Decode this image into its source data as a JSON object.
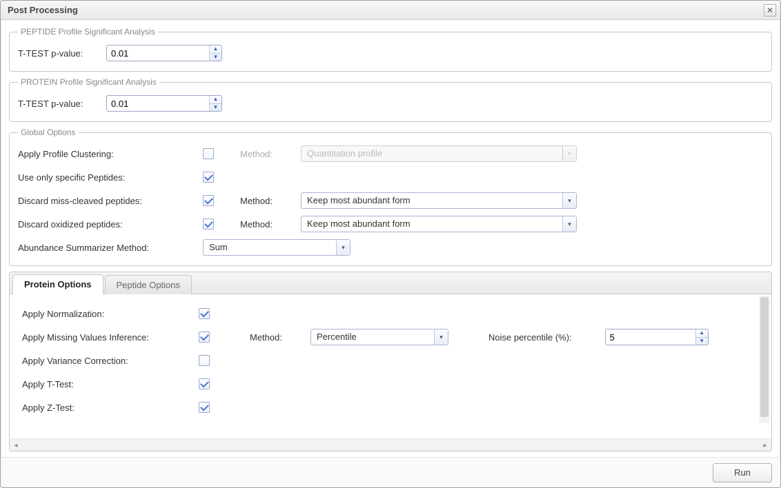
{
  "window": {
    "title": "Post Processing"
  },
  "peptide_profile": {
    "legend": "PEPTIDE Profile Significant Analysis",
    "pvalue_label": "T-TEST p-value:",
    "pvalue": "0.01"
  },
  "protein_profile": {
    "legend": "PROTEIN Profile Significant Analysis",
    "pvalue_label": "T-TEST p-value:",
    "pvalue": "0.01"
  },
  "global": {
    "legend": "Global Options",
    "rows": {
      "clustering": {
        "label": "Apply Profile Clustering:",
        "checked": false,
        "method_label": "Method:",
        "method_value": "Quantitation profile",
        "method_disabled": true
      },
      "specific": {
        "label": "Use only specific Peptides:",
        "checked": true
      },
      "miss_cleaved": {
        "label": "Discard miss-cleaved peptides:",
        "checked": true,
        "method_label": "Method:",
        "method_value": "Keep most abundant form"
      },
      "oxidized": {
        "label": "Discard oxidized peptides:",
        "checked": true,
        "method_label": "Method:",
        "method_value": "Keep most abundant form"
      },
      "summarizer": {
        "label": "Abundance Summarizer Method:",
        "value": "Sum"
      }
    }
  },
  "tabs": {
    "protein": "Protein Options",
    "peptide": "Peptide Options"
  },
  "protein_options": {
    "normalization": {
      "label": "Apply Normalization:",
      "checked": true
    },
    "missing": {
      "label": "Apply Missing Values Inference:",
      "checked": true,
      "method_label": "Method:",
      "method_value": "Percentile",
      "noise_label": "Noise percentile (%):",
      "noise_value": "5"
    },
    "variance": {
      "label": "Apply Variance Correction:",
      "checked": false
    },
    "ttest": {
      "label": "Apply T-Test:",
      "checked": true
    },
    "ztest": {
      "label": "Apply Z-Test:",
      "checked": true
    }
  },
  "footer": {
    "run": "Run"
  }
}
